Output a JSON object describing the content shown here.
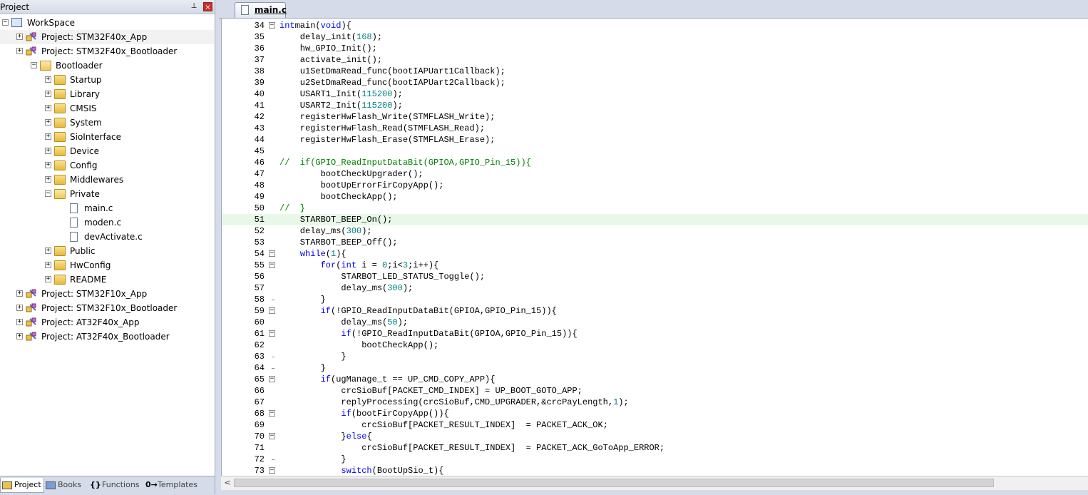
{
  "project_panel": {
    "title": "Project",
    "pin_glyph": "⊥",
    "close_glyph": "×",
    "tree": [
      {
        "label": "WorkSpace",
        "type": "workspace",
        "depth": 0,
        "expander": "−"
      },
      {
        "label": "Project: STM32F40x_App",
        "type": "project",
        "depth": 1,
        "expander": "+",
        "selected": true
      },
      {
        "label": "Project: STM32F40x_Bootloader",
        "type": "project",
        "depth": 1,
        "expander": "+"
      },
      {
        "label": "Bootloader",
        "type": "target",
        "depth": 2,
        "expander": "−"
      },
      {
        "label": "Startup",
        "type": "folder",
        "depth": 3,
        "expander": "+"
      },
      {
        "label": "Library",
        "type": "folder",
        "depth": 3,
        "expander": "+"
      },
      {
        "label": "CMSIS",
        "type": "folder",
        "depth": 3,
        "expander": "+"
      },
      {
        "label": "System",
        "type": "folder",
        "depth": 3,
        "expander": "+"
      },
      {
        "label": "SioInterface",
        "type": "group",
        "depth": 3,
        "expander": "+"
      },
      {
        "label": "Device",
        "type": "folder",
        "depth": 3,
        "expander": "+"
      },
      {
        "label": "Config",
        "type": "folder",
        "depth": 3,
        "expander": "+"
      },
      {
        "label": "Middlewares",
        "type": "folder",
        "depth": 3,
        "expander": "+"
      },
      {
        "label": "Private",
        "type": "folder-open",
        "depth": 3,
        "expander": "−"
      },
      {
        "label": "main.c",
        "type": "file",
        "depth": 4,
        "expander": ""
      },
      {
        "label": "moden.c",
        "type": "file",
        "depth": 4,
        "expander": ""
      },
      {
        "label": "devActivate.c",
        "type": "file",
        "depth": 4,
        "expander": ""
      },
      {
        "label": "Public",
        "type": "folder",
        "depth": 3,
        "expander": "+"
      },
      {
        "label": "HwConfig",
        "type": "folder",
        "depth": 3,
        "expander": "+"
      },
      {
        "label": "README",
        "type": "folder",
        "depth": 3,
        "expander": "+"
      },
      {
        "label": "Project: STM32F10x_App",
        "type": "project",
        "depth": 1,
        "expander": "+"
      },
      {
        "label": "Project: STM32F10x_Bootloader",
        "type": "project",
        "depth": 1,
        "expander": "+"
      },
      {
        "label": "Project: AT32F40x_App",
        "type": "project",
        "depth": 1,
        "expander": "+"
      },
      {
        "label": "Project: AT32F40x_Bootloader",
        "type": "project",
        "depth": 1,
        "expander": "+"
      }
    ],
    "bottom_tabs": [
      {
        "label": "Project",
        "icon": "project-icon",
        "active": true
      },
      {
        "label": "Books",
        "icon": "books-icon",
        "active": false
      },
      {
        "label": "Functions",
        "icon": "functions-icon",
        "glyph": "{}",
        "active": false
      },
      {
        "label": "Templates",
        "icon": "templates-icon",
        "glyph": "0→",
        "active": false
      }
    ]
  },
  "editor": {
    "tab_label": "main.c",
    "scroll_left_glyph": "<",
    "lines": [
      {
        "n": "34",
        "fold": "−",
        "tokens": [
          [
            "kw",
            "int"
          ],
          [
            "",
            "main("
          ],
          [
            "kw",
            "void"
          ],
          [
            "",
            "){"
          ]
        ]
      },
      {
        "n": "35",
        "tokens": [
          [
            "",
            "    delay_init("
          ],
          [
            "num",
            "168"
          ],
          [
            "",
            ");"
          ]
        ]
      },
      {
        "n": "36",
        "tokens": [
          [
            "",
            "    hw_GPIO_Init();"
          ]
        ]
      },
      {
        "n": "37",
        "tokens": [
          [
            "",
            "    activate_init();"
          ]
        ]
      },
      {
        "n": "38",
        "tokens": [
          [
            "",
            "    u1SetDmaRead_func(bootIAPUart1Callback);"
          ]
        ]
      },
      {
        "n": "39",
        "tokens": [
          [
            "",
            "    u2SetDmaRead_func(bootIAPUart2Callback);"
          ]
        ]
      },
      {
        "n": "40",
        "tokens": [
          [
            "",
            "    USART1_Init("
          ],
          [
            "num",
            "115200"
          ],
          [
            "",
            ");"
          ]
        ]
      },
      {
        "n": "41",
        "tokens": [
          [
            "",
            "    USART2_Init("
          ],
          [
            "num",
            "115200"
          ],
          [
            "",
            ");"
          ]
        ]
      },
      {
        "n": "42",
        "tokens": [
          [
            "",
            "    registerHwFlash_Write(STMFLASH_Write);"
          ]
        ]
      },
      {
        "n": "43",
        "tokens": [
          [
            "",
            "    registerHwFlash_Read(STMFLASH_Read);"
          ]
        ]
      },
      {
        "n": "44",
        "tokens": [
          [
            "",
            "    registerHwFlash_Erase(STMFLASH_Erase);"
          ]
        ]
      },
      {
        "n": "45",
        "tokens": []
      },
      {
        "n": "46",
        "tokens": [
          [
            "cm",
            "//  if(GPIO_ReadInputDataBit(GPIOA,GPIO_Pin_15)){"
          ]
        ]
      },
      {
        "n": "47",
        "tokens": [
          [
            "",
            "        bootCheckUpgrader();"
          ]
        ]
      },
      {
        "n": "48",
        "tokens": [
          [
            "",
            "        bootUpErrorFirCopyApp();"
          ]
        ]
      },
      {
        "n": "49",
        "tokens": [
          [
            "",
            "        bootCheckApp();"
          ]
        ]
      },
      {
        "n": "50",
        "tokens": [
          [
            "cm",
            "//  }"
          ]
        ]
      },
      {
        "n": "51",
        "hl": true,
        "tokens": [
          [
            "",
            "    STARBOT_BEEP_On();"
          ]
        ]
      },
      {
        "n": "52",
        "tokens": [
          [
            "",
            "    delay_ms("
          ],
          [
            "num",
            "300"
          ],
          [
            "",
            ");"
          ]
        ]
      },
      {
        "n": "53",
        "tokens": [
          [
            "",
            "    STARBOT_BEEP_Off();"
          ]
        ]
      },
      {
        "n": "54",
        "fold": "−",
        "tokens": [
          [
            "",
            "    "
          ],
          [
            "kw",
            "while"
          ],
          [
            "",
            "("
          ],
          [
            "num",
            "1"
          ],
          [
            "",
            "){"
          ]
        ]
      },
      {
        "n": "55",
        "fold": "−",
        "tokens": [
          [
            "",
            "        "
          ],
          [
            "kw",
            "for"
          ],
          [
            "",
            "("
          ],
          [
            "kw",
            "int"
          ],
          [
            "",
            " i = "
          ],
          [
            "num",
            "0"
          ],
          [
            "",
            ";i<"
          ],
          [
            "num",
            "3"
          ],
          [
            "",
            ";i++){"
          ]
        ]
      },
      {
        "n": "56",
        "tokens": [
          [
            "",
            "            STARBOT_LED_STATUS_Toggle();"
          ]
        ]
      },
      {
        "n": "57",
        "tokens": [
          [
            "",
            "            delay_ms("
          ],
          [
            "num",
            "300"
          ],
          [
            "",
            ");"
          ]
        ]
      },
      {
        "n": "58",
        "foldend": true,
        "tokens": [
          [
            "",
            "        }"
          ]
        ]
      },
      {
        "n": "59",
        "fold": "−",
        "tokens": [
          [
            "",
            "        "
          ],
          [
            "kw",
            "if"
          ],
          [
            "",
            "(!GPIO_ReadInputDataBit(GPIOA,GPIO_Pin_15)){"
          ]
        ]
      },
      {
        "n": "60",
        "tokens": [
          [
            "",
            "            delay_ms("
          ],
          [
            "num",
            "50"
          ],
          [
            "",
            ");"
          ]
        ]
      },
      {
        "n": "61",
        "fold": "−",
        "tokens": [
          [
            "",
            "            "
          ],
          [
            "kw",
            "if"
          ],
          [
            "",
            "(!GPIO_ReadInputDataBit(GPIOA,GPIO_Pin_15)){"
          ]
        ]
      },
      {
        "n": "62",
        "tokens": [
          [
            "",
            "                bootCheckApp();"
          ]
        ]
      },
      {
        "n": "63",
        "foldend": true,
        "tokens": [
          [
            "",
            "            }"
          ]
        ]
      },
      {
        "n": "64",
        "foldend": true,
        "tokens": [
          [
            "",
            "        }"
          ]
        ]
      },
      {
        "n": "65",
        "fold": "−",
        "tokens": [
          [
            "",
            "        "
          ],
          [
            "kw",
            "if"
          ],
          [
            "",
            "(ugManage_t == UP_CMD_COPY_APP){"
          ]
        ]
      },
      {
        "n": "66",
        "tokens": [
          [
            "",
            "            crcSioBuf[PACKET_CMD_INDEX] = UP_BOOT_GOTO_APP;"
          ]
        ]
      },
      {
        "n": "67",
        "tokens": [
          [
            "",
            "            replyProcessing(crcSioBuf,CMD_UPGRADER,&crcPayLength,"
          ],
          [
            "num",
            "1"
          ],
          [
            "",
            ");"
          ]
        ]
      },
      {
        "n": "68",
        "fold": "−",
        "tokens": [
          [
            "",
            "            "
          ],
          [
            "kw",
            "if"
          ],
          [
            "",
            "(bootFirCopyApp()){"
          ]
        ]
      },
      {
        "n": "69",
        "tokens": [
          [
            "",
            "                crcSioBuf[PACKET_RESULT_INDEX]  = PACKET_ACK_OK;"
          ]
        ]
      },
      {
        "n": "70",
        "fold": "−",
        "tokens": [
          [
            "",
            "            }"
          ],
          [
            "kw",
            "else"
          ],
          [
            "",
            "{"
          ]
        ]
      },
      {
        "n": "71",
        "tokens": [
          [
            "",
            "                crcSioBuf[PACKET_RESULT_INDEX]  = PACKET_ACK_GoToApp_ERROR;"
          ]
        ]
      },
      {
        "n": "72",
        "foldend": true,
        "tokens": [
          [
            "",
            "            }"
          ]
        ]
      },
      {
        "n": "73",
        "fold": "−",
        "tokens": [
          [
            "",
            "            "
          ],
          [
            "kw",
            "switch"
          ],
          [
            "",
            "(BootUpSio_t){"
          ]
        ]
      }
    ]
  }
}
